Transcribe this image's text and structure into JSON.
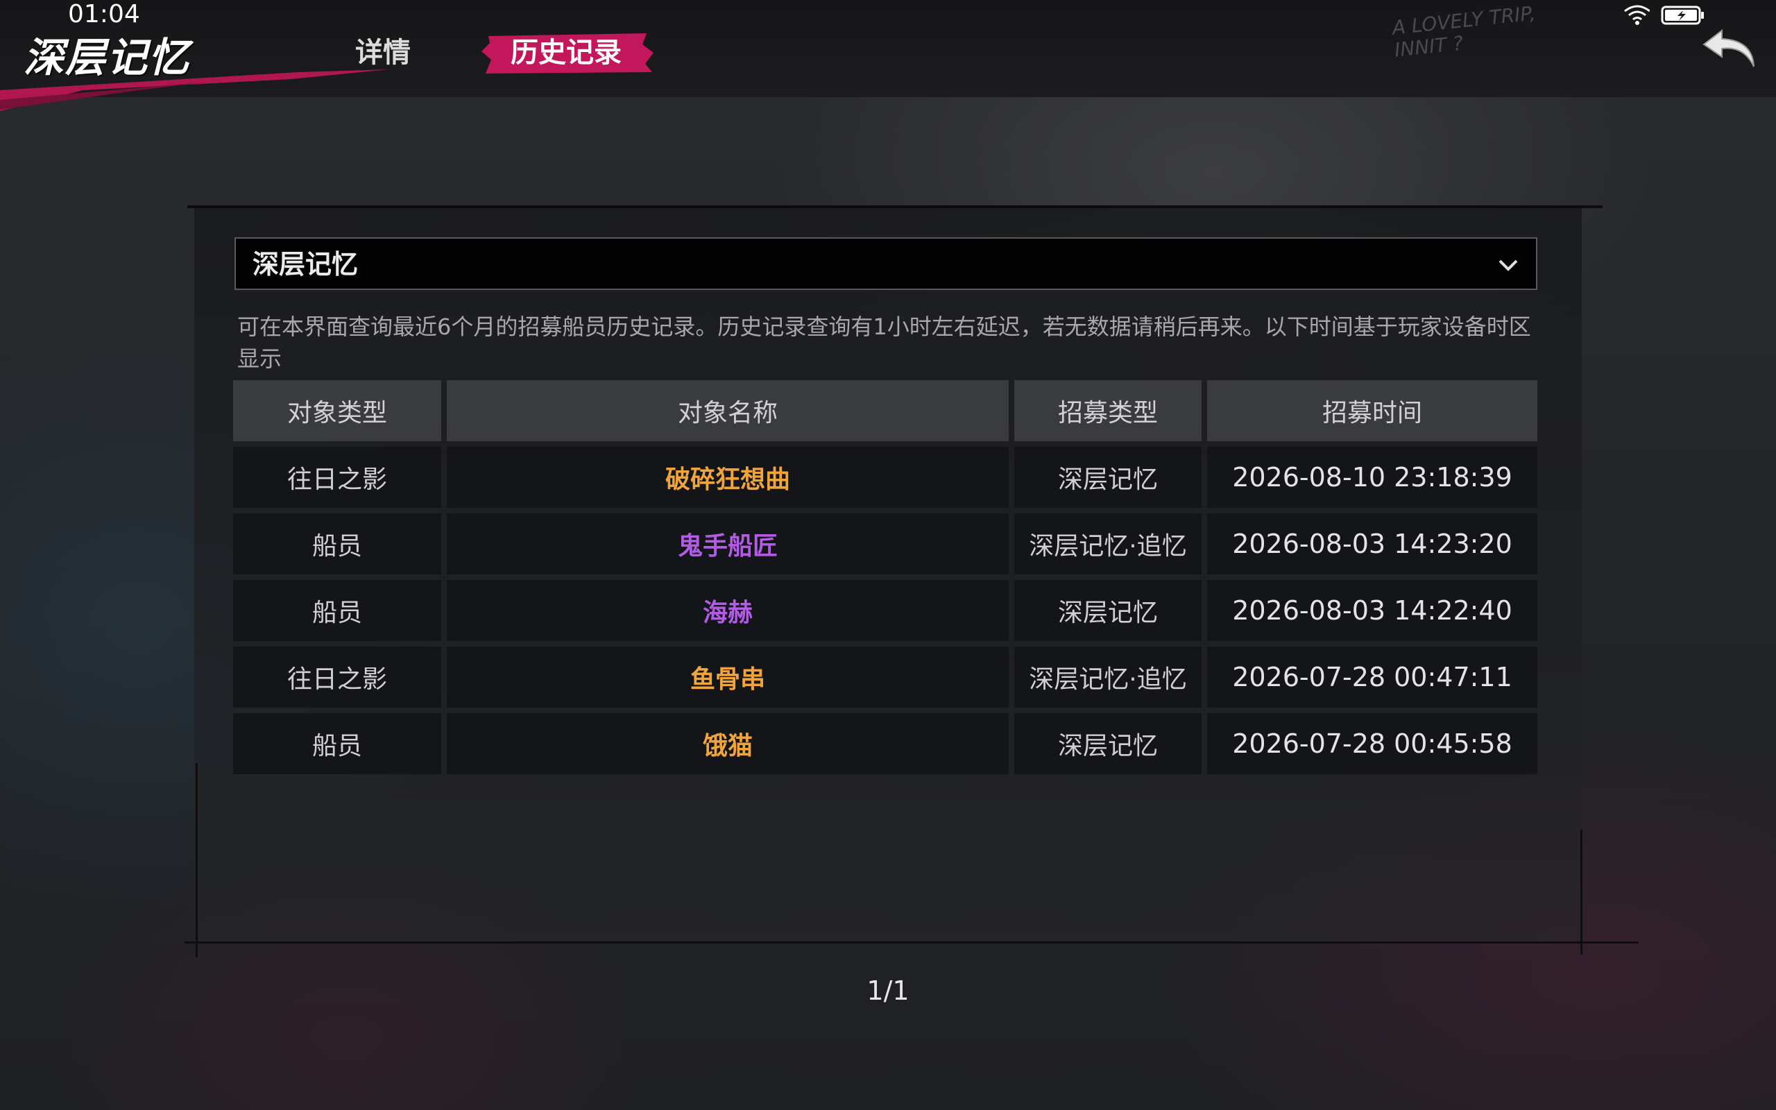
{
  "status_bar": {
    "time": "01:04"
  },
  "app_title": "深层记忆",
  "tabs": [
    {
      "label": "详情",
      "active": false
    },
    {
      "label": "历史记录",
      "active": true
    }
  ],
  "scribble_text": [
    "A LOVELY TRIP,",
    "INNIT ?"
  ],
  "colors": {
    "accent": "#c2185b",
    "orange": "#f0a43a",
    "purple": "#b25ce6"
  },
  "dropdown": {
    "selected": "深层记忆"
  },
  "notice": "可在本界面查询最近6个月的招募船员历史记录。历史记录查询有1小时左右延迟，若无数据请稍后再来。以下时间基于玩家设备时区显示",
  "table": {
    "headers": [
      "对象类型",
      "对象名称",
      "招募类型",
      "招募时间"
    ],
    "rows": [
      {
        "type": "往日之影",
        "name": "破碎狂想曲",
        "name_color": "orange",
        "recruit": "深层记忆",
        "time": "2026-08-10 23:18:39"
      },
      {
        "type": "船员",
        "name": "鬼手船匠",
        "name_color": "purple",
        "recruit": "深层记忆·追忆",
        "time": "2026-08-03 14:23:20"
      },
      {
        "type": "船员",
        "name": "海赫",
        "name_color": "purple",
        "recruit": "深层记忆",
        "time": "2026-08-03 14:22:40"
      },
      {
        "type": "往日之影",
        "name": "鱼骨串",
        "name_color": "orange",
        "recruit": "深层记忆·追忆",
        "time": "2026-07-28 00:47:11"
      },
      {
        "type": "船员",
        "name": "饿猫",
        "name_color": "orange",
        "recruit": "深层记忆",
        "time": "2026-07-28 00:45:58"
      }
    ]
  },
  "pager": "1/1",
  "icons": {
    "wifi": "wifi-icon",
    "battery": "battery-charging-icon",
    "back": "back-arrow-icon",
    "dropdown": "chevron-down-icon"
  }
}
